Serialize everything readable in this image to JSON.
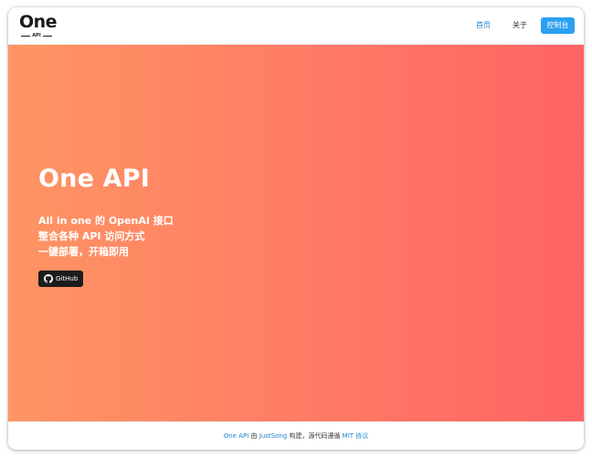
{
  "header": {
    "logo": {
      "word": "One",
      "sub": "API"
    },
    "nav": {
      "home_label": "首页",
      "about_label": "关于",
      "console_label": "控制台"
    }
  },
  "hero": {
    "title": "One API",
    "lines": [
      "All in one 的 OpenAI 接口",
      "整合各种 API 访问方式",
      "一键部署，开箱即用"
    ],
    "github_label": "GitHub"
  },
  "footer": {
    "project_link": "One API",
    "text_by": " 由 ",
    "author_link": "JustSong",
    "text_built": " 构建，源代码遵循 ",
    "license_link": "MIT 协议"
  },
  "colors": {
    "accent": "#2185d0",
    "console_button": "#2ba0f0",
    "hero_gradient_start": "#fe9563",
    "hero_gradient_end": "#ff6464",
    "github_button": "#1b1c1d"
  }
}
